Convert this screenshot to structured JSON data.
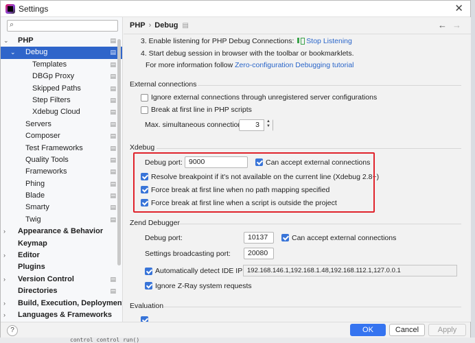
{
  "window": {
    "title": "Settings",
    "close_glyph": "✕",
    "icon": "phpstorm-app-icon"
  },
  "sidebar": {
    "search_placeholder": "Q▾",
    "items": [
      {
        "label": "PHP",
        "level": 0,
        "bold": true,
        "expanded": true,
        "project": true
      },
      {
        "label": "Debug",
        "level": 1,
        "expanded": true,
        "selected": true,
        "project": true
      },
      {
        "label": "Templates",
        "level": 2,
        "project": true
      },
      {
        "label": "DBGp Proxy",
        "level": 2,
        "project": true
      },
      {
        "label": "Skipped Paths",
        "level": 2,
        "project": true
      },
      {
        "label": "Step Filters",
        "level": 2,
        "project": true
      },
      {
        "label": "Xdebug Cloud",
        "level": 2,
        "project": true
      },
      {
        "label": "Servers",
        "level": 1,
        "project": true
      },
      {
        "label": "Composer",
        "level": 1,
        "project": true
      },
      {
        "label": "Test Frameworks",
        "level": 1,
        "project": true
      },
      {
        "label": "Quality Tools",
        "level": 1,
        "project": true
      },
      {
        "label": "Frameworks",
        "level": 1,
        "project": true
      },
      {
        "label": "Phing",
        "level": 1,
        "project": true
      },
      {
        "label": "Blade",
        "level": 1,
        "project": true
      },
      {
        "label": "Smarty",
        "level": 1,
        "project": true
      },
      {
        "label": "Twig",
        "level": 1,
        "project": true
      },
      {
        "label": "Appearance & Behavior",
        "level": 0,
        "bold": true,
        "collapsed": true
      },
      {
        "label": "Keymap",
        "level": 0,
        "bold": true
      },
      {
        "label": "Editor",
        "level": 0,
        "bold": true,
        "collapsed": true
      },
      {
        "label": "Plugins",
        "level": 0,
        "bold": true
      },
      {
        "label": "Version Control",
        "level": 0,
        "bold": true,
        "collapsed": true,
        "project": true
      },
      {
        "label": "Directories",
        "level": 0,
        "bold": true,
        "project": true
      },
      {
        "label": "Build, Execution, Deployment",
        "level": 0,
        "bold": true,
        "collapsed": true
      },
      {
        "label": "Languages & Frameworks",
        "level": 0,
        "bold": true,
        "collapsed": true
      }
    ]
  },
  "header": {
    "crumb_parent": "PHP",
    "crumb_separator": "›",
    "crumb_current": "Debug",
    "project_glyph": "▤",
    "back_glyph": "←",
    "forward_glyph": "→"
  },
  "steps": {
    "step3_text": "3. Enable listening for PHP Debug Connections:",
    "step3_link": "Stop Listening",
    "step4_text": "4. Start debug session in browser with the toolbar or bookmarklets.",
    "more_info_prefix": "For more information follow",
    "more_info_link": "Zero-configuration Debugging tutorial"
  },
  "external": {
    "title": "External connections",
    "ignore_label": "Ignore external connections through unregistered server configurations",
    "ignore_checked": false,
    "break_label": "Break at first line in PHP scripts",
    "break_checked": false,
    "max_label": "Max. simultaneous connections:",
    "max_value": "3",
    "spin_up": "▲",
    "spin_down": "▼"
  },
  "xdebug": {
    "title": "Xdebug",
    "port_label": "Debug port:",
    "port_value": "9000",
    "accept_label": "Can accept external connections",
    "accept_checked": true,
    "resolve_label": "Resolve breakpoint if it's not available on the current line (Xdebug 2.8+)",
    "resolve_checked": true,
    "force_nomap_label": "Force break at first line when no path mapping specified",
    "force_nomap_checked": true,
    "force_outside_label": "Force break at first line when a script is outside the project",
    "force_outside_checked": true,
    "highlight_color": "#e0222b"
  },
  "zend": {
    "title": "Zend Debugger",
    "port_label": "Debug port:",
    "port_value": "10137",
    "accept_label": "Can accept external connections",
    "accept_checked": true,
    "broadcast_label": "Settings broadcasting port:",
    "broadcast_value": "20080",
    "auto_detect_label": "Automatically detect IDE IP:",
    "auto_detect_checked": true,
    "ip_value": "192.168.146.1,192.168.1.48,192.168.112.1,127.0.0.1",
    "ignore_zray_label": "Ignore Z-Ray system requests",
    "ignore_zray_checked": true
  },
  "evaluation": {
    "title": "Evaluation"
  },
  "footer": {
    "help_glyph": "?",
    "ok_label": "OK",
    "cancel_label": "Cancel",
    "apply_label": "Apply",
    "accent_color": "#3574f0"
  },
  "background": {
    "text": "control    control run()"
  }
}
